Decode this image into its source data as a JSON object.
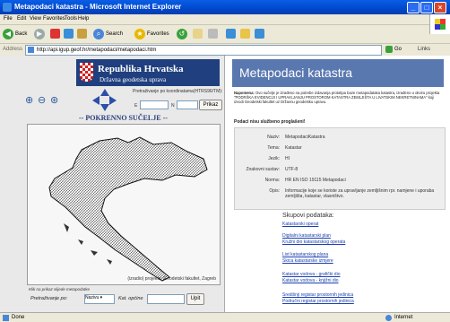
{
  "window": {
    "title": "Metapodaci katastra - Microsoft Internet Explorer"
  },
  "menu": [
    "File",
    "Edit",
    "View",
    "Favorites",
    "Tools",
    "Help"
  ],
  "toolbar": {
    "back": "Back",
    "search": "Search",
    "favorites": "Favorites"
  },
  "address": {
    "label": "Address",
    "url": "http://api.igup.geof.hr/metapodaci/metapodaci.htm",
    "go": "Go",
    "links": "Links"
  },
  "left": {
    "banner_title": "Republika Hrvatska",
    "banner_sub": "Državna geodetska uprava",
    "coord_label": "Pretraživanje po koordinatama(HTRS96/TM):",
    "dim_x": "E",
    "dim_y": "N",
    "coord_button": "Prikaz",
    "map_title": "-- POKRENNO SUČELJE --",
    "map_credit": "(izradio) projekta: Geodetski fakultet, Zagreb",
    "map_link": "Klik na prikaz slijede metapodatke",
    "search_label": "Pretraživanje po:",
    "search_select": "Nazivu",
    "search_label2": "Kat. općine",
    "search_button": "Upit"
  },
  "right": {
    "header": "Metapodaci katastra",
    "intro_bold": "Napomena:",
    "intro": "Ovo sučelje je izrađeno na potrebe izdavanja prototipa baze metapodataka katastra, izrađeno u okviru projekta \"PODRŠKA EVIDENCIJI I UPRAVLJANJU PROSTOROM KATASTRA ZEMLJIŠTA U LIVATSKIM NEKRETNINAMA\" koji izvodi Geodetski fakultet uz Državnu geodetsku upravu.",
    "subhead": "Podaci nisu službeno proglašeni!",
    "meta": [
      {
        "k": "Naziv:",
        "v": "MetapodaciKatastra"
      },
      {
        "k": "Tema:",
        "v": "Katastar"
      },
      {
        "k": "Jezik:",
        "v": "HI"
      },
      {
        "k": "Znakovni sustav:",
        "v": "UTF-8"
      },
      {
        "k": "Norma:",
        "v": "HR EN ISO 19115 Metapodaci"
      },
      {
        "k": "Opis:",
        "v": "Informacije koje se koriste za upravljanje zemljišnim rpr. namjene i uporaba zemljišta, katastar, vlasništvo."
      }
    ],
    "skupovi": "Skupovi podataka:",
    "links": [
      "Katastarski operat",
      "Digitalni katastarski plan",
      "Kružni dio katastarskog operata",
      "List katastarskog plana",
      "Skica katastarske izmjere",
      "Katastar vodova - grafički dio",
      "Katastar vodova - knjižni dio",
      "Središnji registar prostornih jedinica",
      "Područni registar prostornih jedinica"
    ]
  },
  "status": {
    "left": "Done",
    "zone": "Internet"
  }
}
